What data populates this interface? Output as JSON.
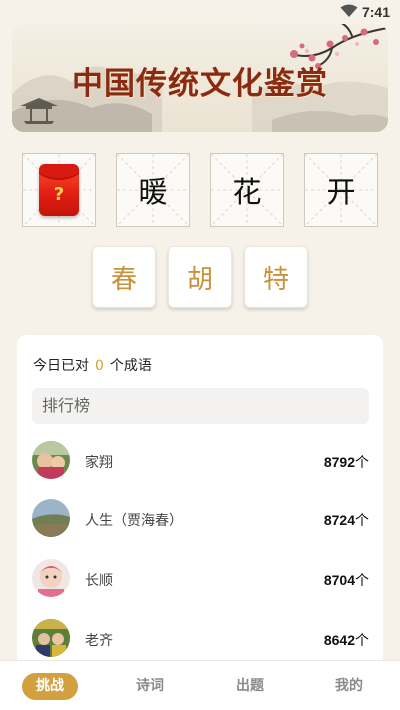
{
  "status_bar": {
    "time": "7:41",
    "wifi_icon": "wifi-icon"
  },
  "banner": {
    "title": "中国传统文化鉴赏"
  },
  "answer_slots": [
    {
      "type": "hint",
      "icon": "red-envelope-hint-icon",
      "label": "?"
    },
    {
      "type": "char",
      "char": "暖"
    },
    {
      "type": "char",
      "char": "花"
    },
    {
      "type": "char",
      "char": "开"
    }
  ],
  "candidates": [
    "春",
    "胡",
    "特"
  ],
  "stats": {
    "prefix": "今日已对",
    "count": "0",
    "suffix": "个成语"
  },
  "leaderboard": {
    "title": "排行榜",
    "entries": [
      {
        "name": "家翔",
        "score": "8792",
        "unit": "个"
      },
      {
        "name": "人生（贾海春）",
        "score": "8724",
        "unit": "个"
      },
      {
        "name": "长顺",
        "score": "8704",
        "unit": "个"
      },
      {
        "name": "老齐",
        "score": "8642",
        "unit": "个"
      }
    ]
  },
  "nav": {
    "items": [
      {
        "label": "挑战",
        "active": true
      },
      {
        "label": "诗词",
        "active": false
      },
      {
        "label": "出题",
        "active": false
      },
      {
        "label": "我的",
        "active": false
      }
    ]
  },
  "colors": {
    "accent": "#d3a040",
    "candidate_text": "#c8923a",
    "title_red": "#8a2a12"
  }
}
